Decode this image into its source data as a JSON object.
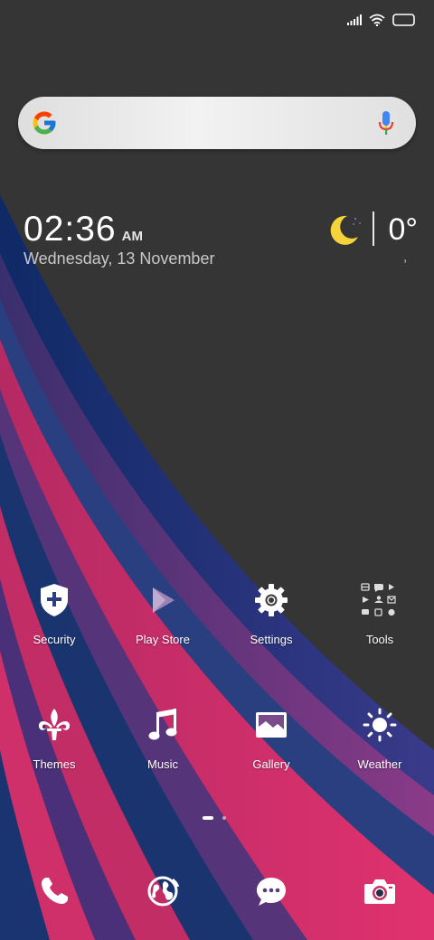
{
  "status_bar": {
    "icons": [
      "signal-icon",
      "wifi-icon",
      "battery-icon"
    ]
  },
  "search": {
    "icons": [
      "google-logo-icon",
      "microphone-icon"
    ]
  },
  "clock": {
    "time": "02:36",
    "ampm": "AM",
    "date": "Wednesday, 13 November"
  },
  "weather": {
    "icon": "moon-icon",
    "temperature": "0°",
    "subtext": ","
  },
  "apps": [
    {
      "label": "Security",
      "icon": "security-shield-icon"
    },
    {
      "label": "Play Store",
      "icon": "play-store-icon"
    },
    {
      "label": "Settings",
      "icon": "gear-icon"
    },
    {
      "label": "Tools",
      "icon": "tools-folder-icon"
    },
    {
      "label": "Themes",
      "icon": "themes-fleur-icon"
    },
    {
      "label": "Music",
      "icon": "music-note-icon"
    },
    {
      "label": "Gallery",
      "icon": "gallery-image-icon"
    },
    {
      "label": "Weather",
      "icon": "sun-icon"
    }
  ],
  "pager": {
    "pages": 2,
    "current": 1
  },
  "dock": [
    {
      "icon": "phone-icon"
    },
    {
      "icon": "browser-globe-icon"
    },
    {
      "icon": "messages-icon"
    },
    {
      "icon": "camera-icon"
    }
  ],
  "colors": {
    "background": "#353535",
    "stripe_navy": "#1f3a78",
    "stripe_purple": "#6a3a7e",
    "stripe_pink": "#c8306a"
  }
}
